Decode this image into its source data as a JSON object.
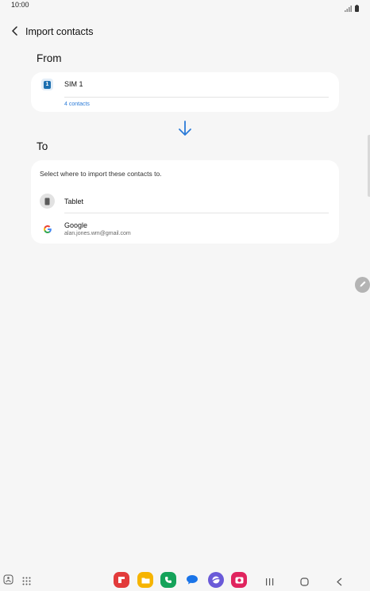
{
  "status_bar": {
    "time": "10:00",
    "icons": [
      "signal-icon",
      "battery-icon"
    ]
  },
  "header": {
    "back_icon": "chevron-left-icon",
    "title": "Import contacts"
  },
  "from_section": {
    "label": "From",
    "source": {
      "icon": "sim-card-icon",
      "badge": "1",
      "name": "SIM 1",
      "link": "4 contacts"
    }
  },
  "arrow_icon": "arrow-down-icon",
  "to_section": {
    "label": "To",
    "prompt": "Select where to import these contacts to.",
    "options": [
      {
        "icon": "tablet-icon",
        "name": "Tablet",
        "detail": ""
      },
      {
        "icon": "google-icon",
        "name": "Google",
        "detail": "alan.jones.wm@gmail.com"
      }
    ]
  },
  "floating_button_icon": "pencil-icon",
  "taskbar": {
    "left_icons": [
      "accessibility-icon",
      "app-grid-icon"
    ],
    "apps": [
      {
        "name": "flipboard-app-icon",
        "color": "#e23b3b"
      },
      {
        "name": "my-files-app-icon",
        "color": "#f6b400"
      },
      {
        "name": "phone-app-icon",
        "color": "#15a35a"
      },
      {
        "name": "messages-app-icon",
        "color": "#1a74e8"
      },
      {
        "name": "internet-app-icon",
        "color": "#6a5ad8"
      },
      {
        "name": "camera-app-icon",
        "color": "#e0245e"
      }
    ],
    "nav_icons": [
      "recents-icon",
      "home-icon",
      "back-nav-icon"
    ]
  },
  "colors": {
    "accent": "#2b7bd8",
    "background": "#f6f6f6",
    "card": "#ffffff"
  }
}
